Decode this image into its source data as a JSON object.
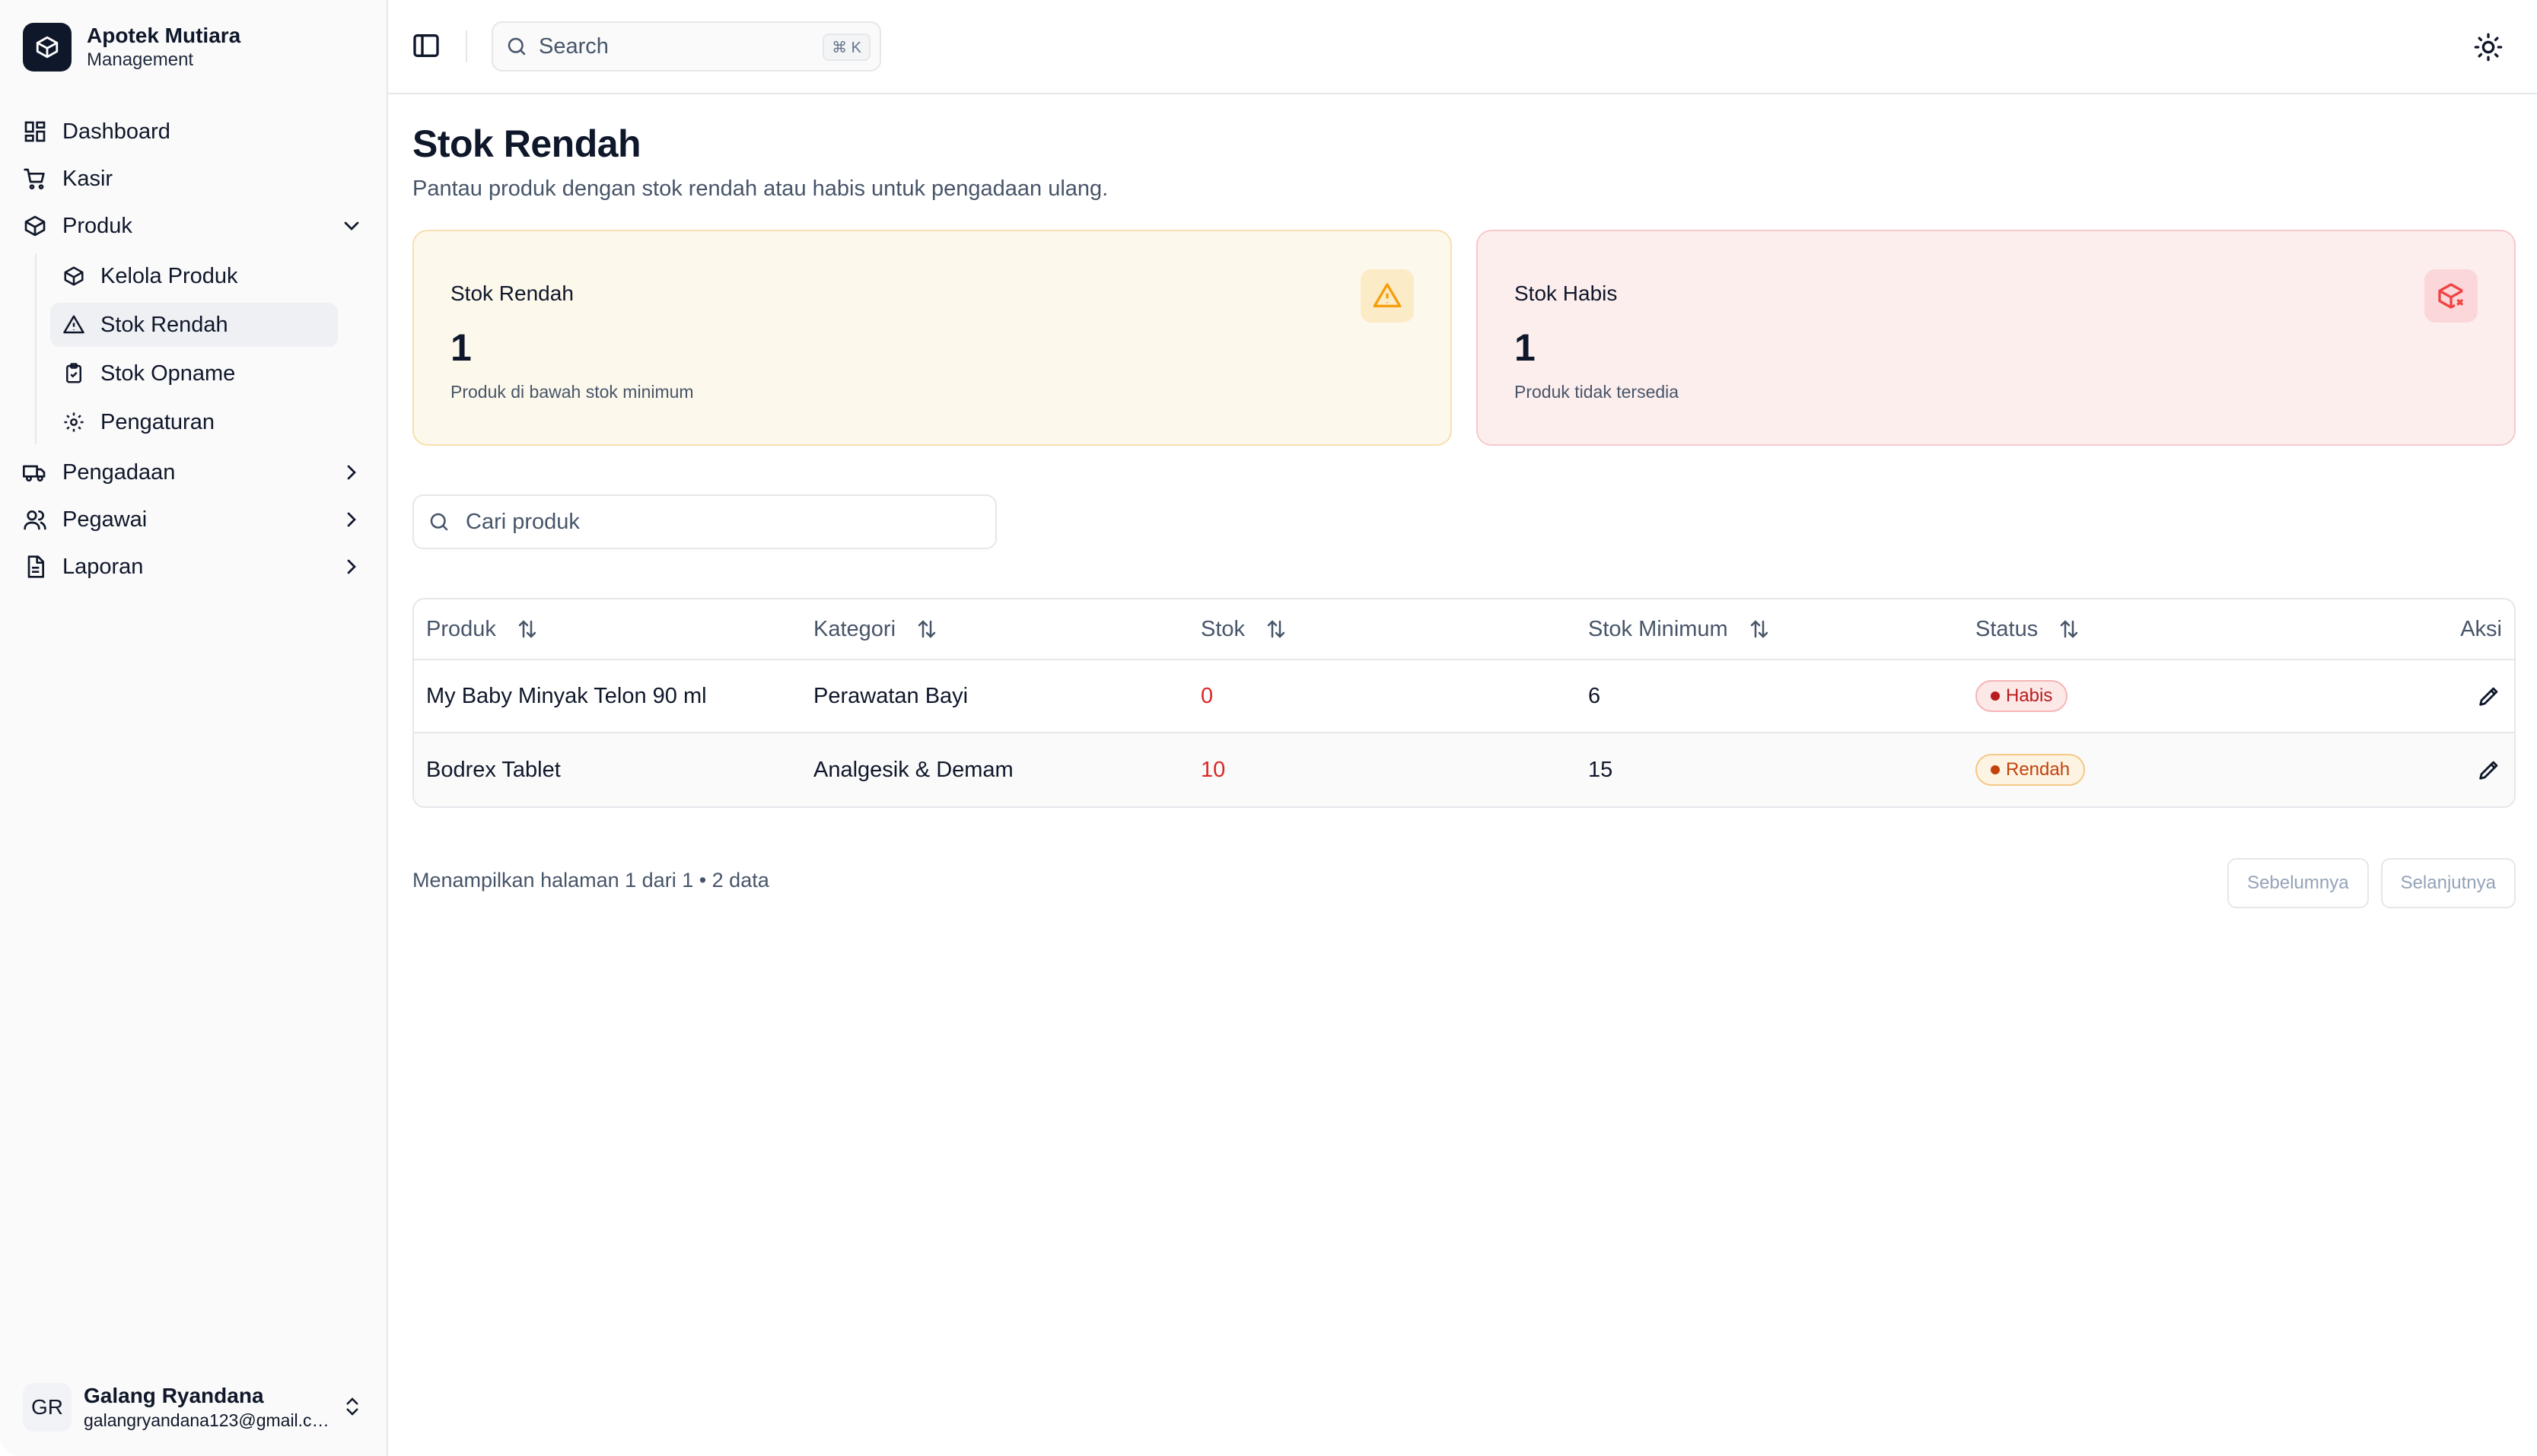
{
  "brand": {
    "name": "Apotek Mutiara",
    "tagline": "Management"
  },
  "nav": {
    "dashboard": "Dashboard",
    "kasir": "Kasir",
    "produk": "Produk",
    "produk_sub": {
      "kelola": "Kelola Produk",
      "stok_rendah": "Stok Rendah",
      "stok_opname": "Stok Opname",
      "pengaturan": "Pengaturan"
    },
    "pengadaan": "Pengadaan",
    "pegawai": "Pegawai",
    "laporan": "Laporan"
  },
  "user": {
    "initials": "GR",
    "name": "Galang Ryandana",
    "email": "galangryandana123@gmail.com"
  },
  "header": {
    "search_placeholder": "Search",
    "shortcut": "⌘ K"
  },
  "page": {
    "title": "Stok Rendah",
    "subtitle": "Pantau produk dengan stok rendah atau habis untuk pengadaan ulang."
  },
  "cards": {
    "low": {
      "title": "Stok Rendah",
      "value": "1",
      "desc": "Produk di bawah stok minimum"
    },
    "out": {
      "title": "Stok Habis",
      "value": "1",
      "desc": "Produk tidak tersedia"
    }
  },
  "filter": {
    "placeholder": "Cari produk"
  },
  "table": {
    "headers": {
      "produk": "Produk",
      "kategori": "Kategori",
      "stok": "Stok",
      "stok_min": "Stok Minimum",
      "status": "Status",
      "aksi": "Aksi"
    },
    "rows": [
      {
        "produk": "My Baby Minyak Telon 90 ml",
        "kategori": "Perawatan Bayi",
        "stok": "0",
        "stok_min": "6",
        "status": "Habis"
      },
      {
        "produk": "Bodrex Tablet",
        "kategori": "Analgesik & Demam",
        "stok": "10",
        "stok_min": "15",
        "status": "Rendah"
      }
    ]
  },
  "pagination": {
    "info": "Menampilkan halaman 1 dari 1 • 2 data",
    "prev": "Sebelumnya",
    "next": "Selanjutnya"
  },
  "colors": {
    "warn": "#f59e0b",
    "danger": "#ef4444",
    "text": "#0f172a"
  }
}
